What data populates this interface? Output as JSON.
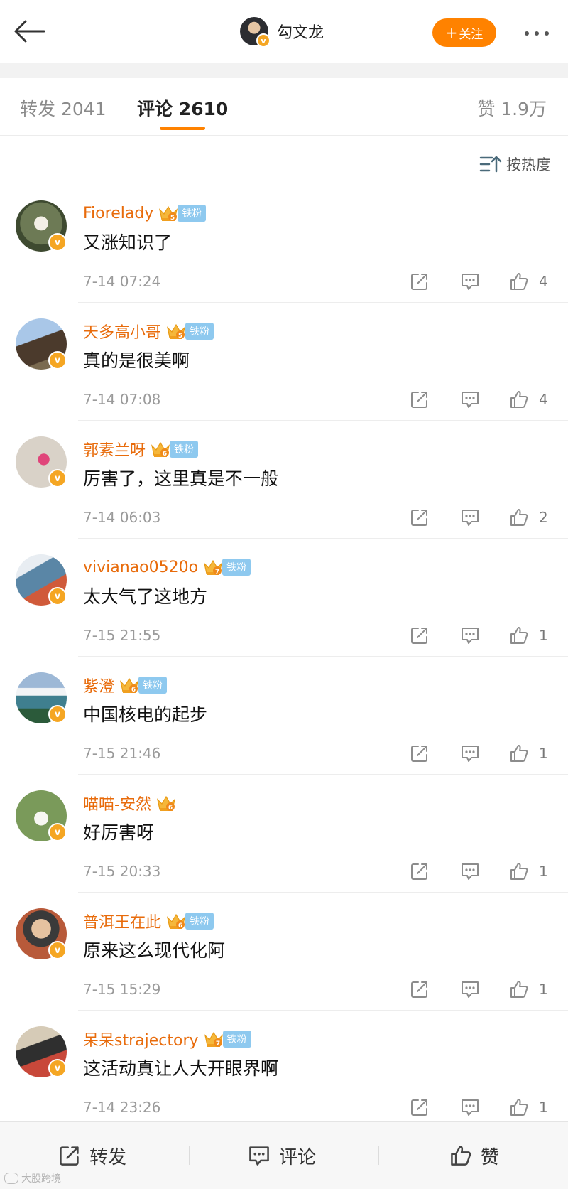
{
  "header": {
    "author_name": "勾文龙",
    "follow_label": "关注",
    "follow_plus": "+"
  },
  "tabs": {
    "repost": "转发 2041",
    "comment": "评论 2610",
    "likes": "赞 1.9万"
  },
  "sort": {
    "label": "按热度"
  },
  "colors": {
    "accent": "#ff8200",
    "username": "#e86b0b",
    "verified_badge": "#f5a623",
    "tiefen_badge": "#8ec9ef"
  },
  "comments": [
    {
      "username": "Fiorelady",
      "crown_level": "5",
      "badge": "铁粉",
      "text": "又涨知识了",
      "time": "7-14 07:24",
      "likes": "4"
    },
    {
      "username": "天多高小哥",
      "crown_level": "5",
      "badge": "铁粉",
      "text": "真的是很美啊",
      "time": "7-14 07:08",
      "likes": "4"
    },
    {
      "username": "郭素兰呀",
      "crown_level": "6",
      "badge": "铁粉",
      "text": "厉害了，这里真是不一般",
      "time": "7-14 06:03",
      "likes": "2"
    },
    {
      "username": "vivianao0520o",
      "crown_level": "7",
      "badge": "铁粉",
      "text": "太大气了这地方",
      "time": "7-15 21:55",
      "likes": "1"
    },
    {
      "username": "紫澄",
      "crown_level": "6",
      "badge": "铁粉",
      "text": "中国核电的起步",
      "time": "7-15 21:46",
      "likes": "1"
    },
    {
      "username": "喵喵-安然",
      "crown_level": "6",
      "badge": "",
      "text": "好厉害呀",
      "time": "7-15 20:33",
      "likes": "1"
    },
    {
      "username": "普洱王在此",
      "crown_level": "6",
      "badge": "铁粉",
      "text": "原来这么现代化阿",
      "time": "7-15 15:29",
      "likes": "1"
    },
    {
      "username": "呆呆strajectory",
      "crown_level": "7",
      "badge": "铁粉",
      "text": "这活动真让人大开眼界啊",
      "time": "7-14 23:26",
      "likes": "1"
    }
  ],
  "bottom_bar": {
    "repost": "转发",
    "comment": "评论",
    "like": "赞"
  },
  "watermark": "大股跨境",
  "verified_mark": "v"
}
